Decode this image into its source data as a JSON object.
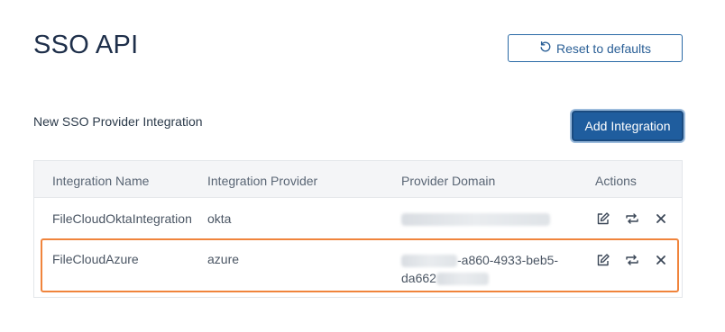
{
  "page": {
    "title": "SSO API",
    "reset_label": "Reset to defaults",
    "section_label": "New SSO Provider Integration",
    "add_label": "Add Integration"
  },
  "table": {
    "columns": [
      "Integration Name",
      "Integration Provider",
      "Provider Domain",
      "Actions"
    ],
    "rows": [
      {
        "name": "FileCloudOktaIntegration",
        "provider": "okta",
        "domain_visible_mid": "",
        "domain_line2": ""
      },
      {
        "name": "FileCloudAzure",
        "provider": "azure",
        "domain_visible_mid": "-a860-4933-beb5-",
        "domain_line2": "da662"
      }
    ]
  },
  "icons": {
    "reset": "reset-icon",
    "edit": "edit-icon",
    "sync": "sync-icon",
    "delete": "close-icon"
  },
  "colors": {
    "primary": "#1f5d9e",
    "highlight": "#f0843c"
  }
}
